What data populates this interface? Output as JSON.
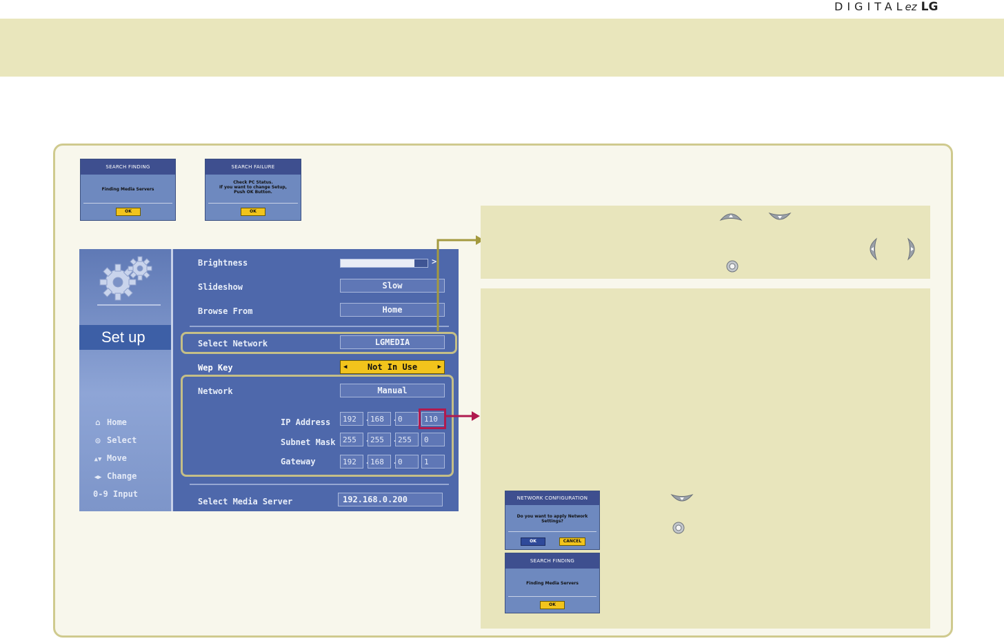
{
  "brand": {
    "digital": "DIGITAL",
    "ez": "ez",
    "lg": "LG"
  },
  "dialogs": {
    "search_finding_1": {
      "title": "SEARCH FINDING",
      "message": "Finding Media Servers",
      "ok": "OK"
    },
    "search_failure": {
      "title": "SEARCH FAILURE",
      "line1": "Check PC Status.",
      "line2": "If you want to change Setup,",
      "line3": "Push OK Button.",
      "ok": "OK"
    },
    "network_config": {
      "title": "NETWORK CONFIGURATION",
      "message": "Do you want to apply Network Settings?",
      "ok": "OK",
      "cancel": "CANCEL"
    },
    "search_finding_2": {
      "title": "SEARCH FINDING",
      "message": "Finding Media Servers",
      "ok": "OK"
    }
  },
  "setup_screen": {
    "title": "Set up",
    "nav": [
      {
        "icon": "home-icon",
        "label": "Home"
      },
      {
        "icon": "select-icon",
        "label": "Select"
      },
      {
        "icon": "move-icon",
        "label": "Move"
      },
      {
        "icon": "change-icon",
        "label": "Change"
      },
      {
        "icon": "input-icon",
        "label": "0-9 Input"
      }
    ],
    "brightness_label": "Brightness",
    "brightness_level_percent": 85,
    "slideshow_label": "Slideshow",
    "slideshow_value": "Slow",
    "browse_from_label": "Browse From",
    "browse_from_value": "Home",
    "select_network_label": "Select Network",
    "select_network_value": "LGMEDIA",
    "wep_key_label": "Wep Key",
    "wep_key_value": "Not In Use",
    "network_label": "Network",
    "network_value": "Manual",
    "ip_address_label": "IP Address",
    "ip_address": [
      "192",
      "168",
      "0",
      "110"
    ],
    "subnet_mask_label": "Subnet Mask",
    "subnet_mask": [
      "255",
      "255",
      "255",
      "0"
    ],
    "gateway_label": "Gateway",
    "gateway": [
      "192",
      "168",
      "0",
      "1"
    ],
    "select_media_server_label": "Select Media Server",
    "select_media_server_value": "192.168.0.200"
  },
  "colors": {
    "accent_olive": "#a49a3f",
    "accent_crimson": "#b01a4f",
    "tan": "#e8e5bc"
  }
}
